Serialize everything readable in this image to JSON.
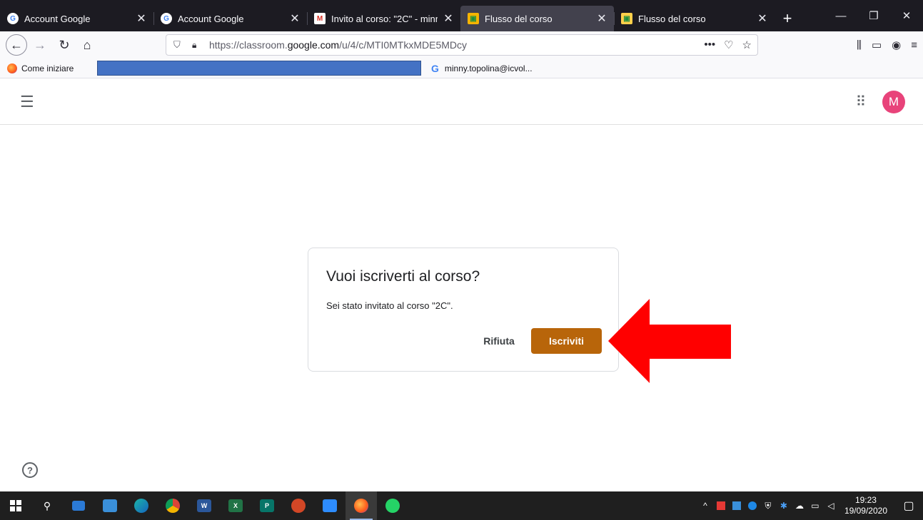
{
  "browser": {
    "tabs": [
      {
        "title": "Account Google",
        "favicon": "google-icon",
        "active": false
      },
      {
        "title": "Account Google",
        "favicon": "google-icon",
        "active": false
      },
      {
        "title": "Invito al corso: \"2C\" - minny.t",
        "favicon": "gmail-icon",
        "active": false
      },
      {
        "title": "Flusso del corso",
        "favicon": "classroom-icon",
        "active": true
      },
      {
        "title": "Flusso del corso",
        "favicon": "classroom-icon",
        "active": false
      }
    ],
    "url_prefix": "https://classroom.",
    "url_domain": "google.com",
    "url_path": "/u/4/c/MTI0MTkxMDE5MDcy",
    "bookmarks": {
      "first": "Come iniziare",
      "second": "minny.topolina@icvol..."
    }
  },
  "classroom": {
    "avatar_letter": "M",
    "avatar_color": "#e8437a"
  },
  "dialog": {
    "title": "Vuoi iscriverti al corso?",
    "body": "Sei stato invitato al corso \"2C\".",
    "decline_label": "Rifiuta",
    "join_label": "Iscriviti",
    "join_color": "#b8650a"
  },
  "annotation": {
    "arrow_color": "#ff0000",
    "arrow_icon": "red-arrow-pointing-left"
  },
  "taskbar": {
    "time": "19:23",
    "date": "19/09/2020"
  }
}
